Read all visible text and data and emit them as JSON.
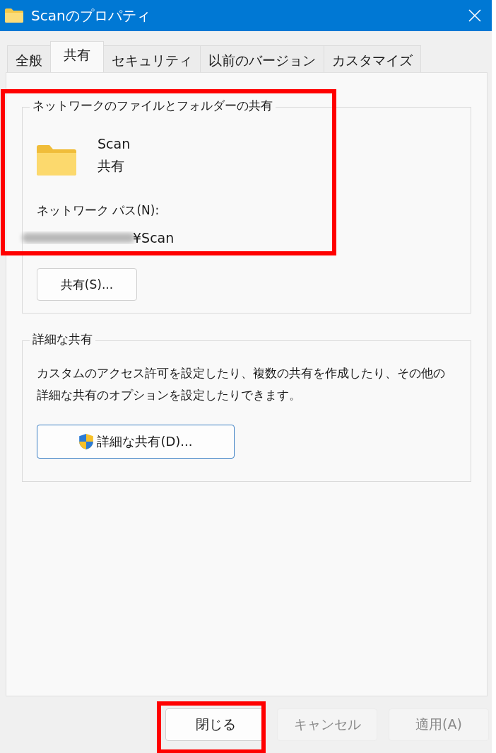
{
  "window": {
    "title": "Scanのプロパティ"
  },
  "tabs": [
    {
      "label": "全般",
      "selected": false
    },
    {
      "label": "共有",
      "selected": true
    },
    {
      "label": "セキュリティ",
      "selected": false
    },
    {
      "label": "以前のバージョン",
      "selected": false
    },
    {
      "label": "カスタマイズ",
      "selected": false
    }
  ],
  "network_sharing": {
    "title": "ネットワークのファイルとフォルダーの共有",
    "highlighted": true,
    "folder_name": "Scan",
    "status": "共有",
    "path_label": "ネットワーク パス(N):",
    "path": "¥Scan",
    "share_button": "共有(S)..."
  },
  "advanced_sharing": {
    "title": "詳細な共有",
    "description": "カスタムのアクセス許可を設定したり、複数の共有を作成したり、その他の詳細な共有のオプションを設定したりできます。",
    "button": "詳細な共有(D)..."
  },
  "buttons": [
    {
      "label": "閉じる",
      "disabled": false,
      "highlighted": true
    },
    {
      "label": "キャンセル",
      "disabled": true,
      "highlighted": false
    },
    {
      "label": "適用(A)",
      "disabled": true,
      "highlighted": false
    }
  ]
}
